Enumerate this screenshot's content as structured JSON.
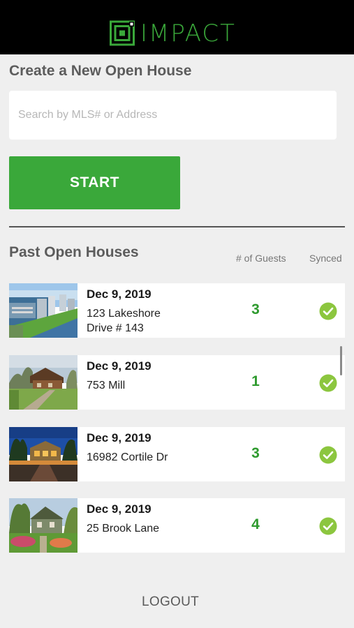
{
  "app": {
    "brand_name": "IMPACT",
    "brand_color": "#3aa83a"
  },
  "new_open_house": {
    "title": "Create a New Open House",
    "search_placeholder": "Search by MLS# or Address",
    "search_value": "",
    "start_label": "START"
  },
  "past": {
    "title": "Past Open Houses",
    "col_guests": "# of Guests",
    "col_synced": "Synced",
    "items": [
      {
        "date": "Dec 9, 2019",
        "address": "123 Lakeshore Drive # 143",
        "guests": "3",
        "synced": true,
        "photo": "waterfront-towers-aerial"
      },
      {
        "date": "Dec 9, 2019",
        "address": "753 Mill",
        "guests": "1",
        "synced": true,
        "photo": "log-cabin-lawn"
      },
      {
        "date": "Dec 9, 2019",
        "address": "16982 Cortile Dr",
        "guests": "3",
        "synced": true,
        "photo": "mansion-night"
      },
      {
        "date": "Dec 9, 2019",
        "address": "25 Brook Lane",
        "guests": "4",
        "synced": true,
        "photo": "cottage-garden"
      }
    ]
  },
  "footer": {
    "logout_label": "LOGOUT"
  }
}
